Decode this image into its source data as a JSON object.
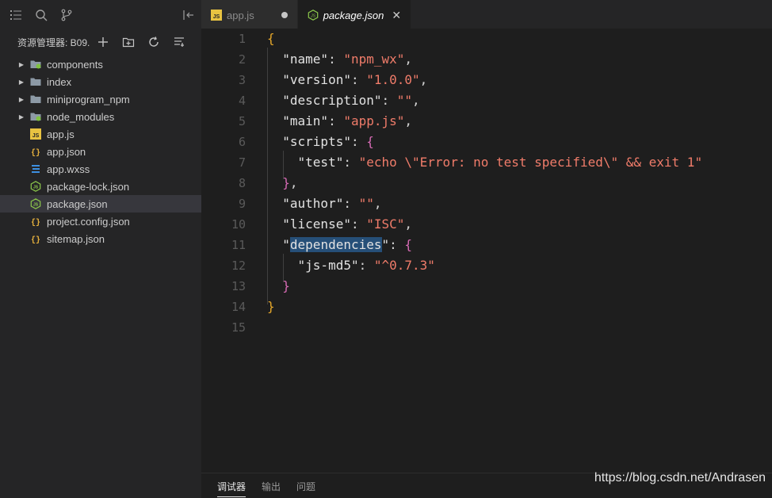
{
  "sidebar": {
    "explorer_title": "资源管理器: B09...",
    "files": [
      {
        "label": "components",
        "type": "folder-green",
        "expandable": true
      },
      {
        "label": "index",
        "type": "folder",
        "expandable": true
      },
      {
        "label": "miniprogram_npm",
        "type": "folder",
        "expandable": true
      },
      {
        "label": "node_modules",
        "type": "folder-green",
        "expandable": true
      },
      {
        "label": "app.js",
        "type": "js",
        "expandable": false
      },
      {
        "label": "app.json",
        "type": "json",
        "expandable": false
      },
      {
        "label": "app.wxss",
        "type": "css",
        "expandable": false
      },
      {
        "label": "package-lock.json",
        "type": "npm",
        "expandable": false
      },
      {
        "label": "package.json",
        "type": "npm",
        "expandable": false,
        "selected": true
      },
      {
        "label": "project.config.json",
        "type": "json",
        "expandable": false
      },
      {
        "label": "sitemap.json",
        "type": "json",
        "expandable": false
      }
    ]
  },
  "tabs": [
    {
      "label": "app.js",
      "icon": "js",
      "modified": true
    },
    {
      "label": "package.json",
      "icon": "npm",
      "active": true
    }
  ],
  "editor": {
    "lines": [
      {
        "n": "1",
        "tokens": [
          [
            "{",
            "b1"
          ]
        ]
      },
      {
        "n": "2",
        "tokens": [
          [
            "  ",
            "p"
          ],
          [
            "\"name\"",
            "k"
          ],
          [
            ": ",
            "p"
          ],
          [
            "\"npm_wx\"",
            "s"
          ],
          [
            ",",
            "p"
          ]
        ]
      },
      {
        "n": "3",
        "tokens": [
          [
            "  ",
            "p"
          ],
          [
            "\"version\"",
            "k"
          ],
          [
            ": ",
            "p"
          ],
          [
            "\"1.0.0\"",
            "s"
          ],
          [
            ",",
            "p"
          ]
        ]
      },
      {
        "n": "4",
        "tokens": [
          [
            "  ",
            "p"
          ],
          [
            "\"description\"",
            "k"
          ],
          [
            ": ",
            "p"
          ],
          [
            "\"\"",
            "s"
          ],
          [
            ",",
            "p"
          ]
        ]
      },
      {
        "n": "5",
        "tokens": [
          [
            "  ",
            "p"
          ],
          [
            "\"main\"",
            "k"
          ],
          [
            ": ",
            "p"
          ],
          [
            "\"app.js\"",
            "s"
          ],
          [
            ",",
            "p"
          ]
        ]
      },
      {
        "n": "6",
        "tokens": [
          [
            "  ",
            "p"
          ],
          [
            "\"scripts\"",
            "k"
          ],
          [
            ": ",
            "p"
          ],
          [
            "{",
            "b2"
          ]
        ]
      },
      {
        "n": "7",
        "tokens": [
          [
            "    ",
            "p"
          ],
          [
            "\"test\"",
            "k"
          ],
          [
            ": ",
            "p"
          ],
          [
            "\"echo \\\"Error: no test specified\\\" && exit 1\"",
            "s"
          ]
        ]
      },
      {
        "n": "8",
        "tokens": [
          [
            "  ",
            "p"
          ],
          [
            "}",
            "b2"
          ],
          [
            ",",
            "p"
          ]
        ]
      },
      {
        "n": "9",
        "tokens": [
          [
            "  ",
            "p"
          ],
          [
            "\"author\"",
            "k"
          ],
          [
            ": ",
            "p"
          ],
          [
            "\"\"",
            "s"
          ],
          [
            ",",
            "p"
          ]
        ]
      },
      {
        "n": "10",
        "tokens": [
          [
            "  ",
            "p"
          ],
          [
            "\"license\"",
            "k"
          ],
          [
            ": ",
            "p"
          ],
          [
            "\"ISC\"",
            "s"
          ],
          [
            ",",
            "p"
          ]
        ]
      },
      {
        "n": "11",
        "tokens": [
          [
            "  ",
            "p"
          ],
          [
            "\"",
            "k"
          ],
          [
            "dependencies",
            "k sel"
          ],
          [
            "\"",
            "k"
          ],
          [
            ": ",
            "p"
          ],
          [
            "{",
            "b2"
          ]
        ]
      },
      {
        "n": "12",
        "tokens": [
          [
            "    ",
            "p"
          ],
          [
            "\"js-md5\"",
            "k"
          ],
          [
            ": ",
            "p"
          ],
          [
            "\"^0.7.3\"",
            "s"
          ]
        ]
      },
      {
        "n": "13",
        "tokens": [
          [
            "  ",
            "p"
          ],
          [
            "}",
            "b2"
          ]
        ]
      },
      {
        "n": "14",
        "tokens": [
          [
            "}",
            "b1"
          ]
        ]
      },
      {
        "n": "15",
        "tokens": []
      }
    ]
  },
  "panel": {
    "tabs": [
      "调试器",
      "输出",
      "问题"
    ]
  },
  "watermark": "https://blog.csdn.net/Andrasen",
  "colors": {
    "key": "#e2e2e2",
    "string": "#f07c6a",
    "bracket_outer": "#e5a72a",
    "bracket_inner": "#d66ab4",
    "selection": "#264f78"
  }
}
